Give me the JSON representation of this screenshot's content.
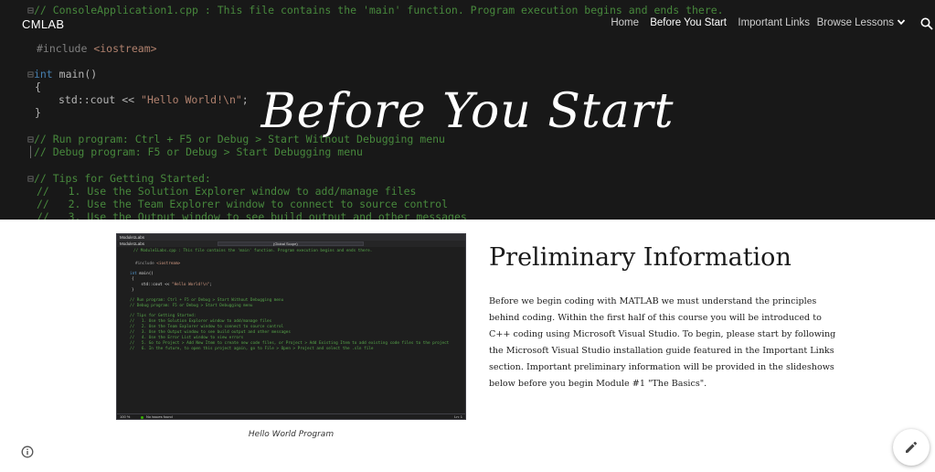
{
  "site": {
    "name": "CMLAB"
  },
  "nav": {
    "items": [
      {
        "label": "Home",
        "active": false
      },
      {
        "label": "Before You Start",
        "active": true
      },
      {
        "label": "Important Links",
        "active": false
      },
      {
        "label": "Browse Lessons",
        "active": false
      }
    ],
    "search_icon": "search-icon",
    "dropdown_icon": "chevron-down-icon"
  },
  "hero": {
    "title": "Before You Start",
    "code": {
      "line1": "// ConsoleApplication1.cpp : This file contains the 'main' function. Program execution begins and ends there.",
      "line2_pre": "#include ",
      "line2_lib": "<iostream>",
      "line3_kw": "int",
      "line3_rest": " main()",
      "line4": "{",
      "line5_pre": "std::cout << ",
      "line5_str": "\"Hello World!\\n\"",
      "line5_end": ";",
      "line6": "}",
      "line7": "// Run program: Ctrl + F5 or Debug > Start Without Debugging menu",
      "line8": "// Debug program: F5 or Debug > Start Debugging menu",
      "line9": "// Tips for Getting Started:",
      "line10": "//   1. Use the Solution Explorer window to add/manage files",
      "line11": "//   2. Use the Team Explorer window to connect to source control",
      "line12": "//   3. Use the Output window to see build output and other messages"
    }
  },
  "figure": {
    "caption": "Hello World Program",
    "screenshot": {
      "title": "Module1Labs",
      "tab": "Module1Labs",
      "dropdown": "(Global Scope)",
      "code": {
        "l1": "// Module1Labs.cpp : This file contains the 'main' function. Program execution begins and ends there.",
        "l2_pre": "#include ",
        "l2_lib": "<iostream>",
        "l3_kw": "int",
        "l3_rest": " main()",
        "l4": "{",
        "l5_pre": "    std::cout << ",
        "l5_str": "\"Hello World!\\n\"",
        "l5_end": ";",
        "l6": "}",
        "l7": "// Run program: Ctrl + F5 or Debug > Start Without Debugging menu",
        "l8": "// Debug program: F5 or Debug > Start Debugging menu",
        "l9": "// Tips for Getting Started:",
        "l10": "//   1. Use the Solution Explorer window to add/manage files",
        "l11": "//   2. Use the Team Explorer window to connect to source control",
        "l12": "//   3. Use the Output window to see build output and other messages",
        "l13": "//   4. Use the Error List window to view errors",
        "l14": "//   5. Go to Project > Add New Item to create new code files, or Project > Add Existing Item to add existing code files to the project",
        "l15": "//   6. In the future, to open this project again, go to File > Open > Project and select the .sln file"
      },
      "status_zoom": "100 %",
      "status_issues": "No issues found",
      "status_ln": "Ln: 1"
    }
  },
  "section": {
    "heading": "Preliminary Information",
    "body": "Before we begin coding with MATLAB we must understand the principles behind coding. Within the first half of this course you will be introduced to C++ coding using Microsoft Visual Studio. To begin, please start by following the Microsoft Visual Studio installation guide featured in the Important Links section. Important preliminary information will be provided in the slideshows below before you begin Module #1 \"The Basics\"."
  },
  "footer": {
    "info_icon": "info-icon",
    "edit_icon": "pencil-icon"
  },
  "colors": {
    "hero_bg": "#1e1e1e",
    "code_comment": "#57a64a",
    "code_keyword": "#569cd6",
    "code_string": "#d69d85",
    "nav_text": "#cfcfcf",
    "nav_active": "#ffffff"
  }
}
